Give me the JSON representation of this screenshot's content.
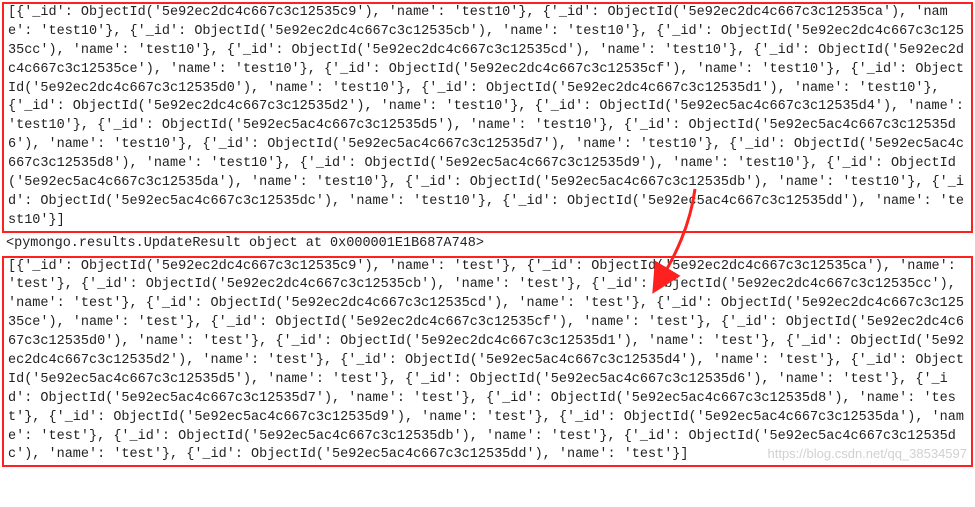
{
  "block1_text": "[{'_id': ObjectId('5e92ec2dc4c667c3c12535c9'), 'name': 'test10'}, {'_id': ObjectId('5e92ec2dc4c667c3c12535ca'), 'name': 'test10'}, {'_id': ObjectId('5e92ec2dc4c667c3c12535cb'), 'name': 'test10'}, {'_id': ObjectId('5e92ec2dc4c667c3c12535cc'), 'name': 'test10'}, {'_id': ObjectId('5e92ec2dc4c667c3c12535cd'), 'name': 'test10'}, {'_id': ObjectId('5e92ec2dc4c667c3c12535ce'), 'name': 'test10'}, {'_id': ObjectId('5e92ec2dc4c667c3c12535cf'), 'name': 'test10'}, {'_id': ObjectId('5e92ec2dc4c667c3c12535d0'), 'name': 'test10'}, {'_id': ObjectId('5e92ec2dc4c667c3c12535d1'), 'name': 'test10'}, {'_id': ObjectId('5e92ec2dc4c667c3c12535d2'), 'name': 'test10'}, {'_id': ObjectId('5e92ec5ac4c667c3c12535d4'), 'name': 'test10'}, {'_id': ObjectId('5e92ec5ac4c667c3c12535d5'), 'name': 'test10'}, {'_id': ObjectId('5e92ec5ac4c667c3c12535d6'), 'name': 'test10'}, {'_id': ObjectId('5e92ec5ac4c667c3c12535d7'), 'name': 'test10'}, {'_id': ObjectId('5e92ec5ac4c667c3c12535d8'), 'name': 'test10'}, {'_id': ObjectId('5e92ec5ac4c667c3c12535d9'), 'name': 'test10'}, {'_id': ObjectId('5e92ec5ac4c667c3c12535da'), 'name': 'test10'}, {'_id': ObjectId('5e92ec5ac4c667c3c12535db'), 'name': 'test10'}, {'_id': ObjectId('5e92ec5ac4c667c3c12535dc'), 'name': 'test10'}, {'_id': ObjectId('5e92ec5ac4c667c3c12535dd'), 'name': 'test10'}]",
  "mid_text": "<pymongo.results.UpdateResult object at 0x000001E1B687A748>",
  "block2_text": "[{'_id': ObjectId('5e92ec2dc4c667c3c12535c9'), 'name': 'test'}, {'_id': ObjectId('5e92ec2dc4c667c3c12535ca'), 'name': 'test'}, {'_id': ObjectId('5e92ec2dc4c667c3c12535cb'), 'name': 'test'}, {'_id': ObjectId('5e92ec2dc4c667c3c12535cc'), 'name': 'test'}, {'_id': ObjectId('5e92ec2dc4c667c3c12535cd'), 'name': 'test'}, {'_id': ObjectId('5e92ec2dc4c667c3c12535ce'), 'name': 'test'}, {'_id': ObjectId('5e92ec2dc4c667c3c12535cf'), 'name': 'test'}, {'_id': ObjectId('5e92ec2dc4c667c3c12535d0'), 'name': 'test'}, {'_id': ObjectId('5e92ec2dc4c667c3c12535d1'), 'name': 'test'}, {'_id': ObjectId('5e92ec2dc4c667c3c12535d2'), 'name': 'test'}, {'_id': ObjectId('5e92ec5ac4c667c3c12535d4'), 'name': 'test'}, {'_id': ObjectId('5e92ec5ac4c667c3c12535d5'), 'name': 'test'}, {'_id': ObjectId('5e92ec5ac4c667c3c12535d6'), 'name': 'test'}, {'_id': ObjectId('5e92ec5ac4c667c3c12535d7'), 'name': 'test'}, {'_id': ObjectId('5e92ec5ac4c667c3c12535d8'), 'name': 'test'}, {'_id': ObjectId('5e92ec5ac4c667c3c12535d9'), 'name': 'test'}, {'_id': ObjectId('5e92ec5ac4c667c3c12535da'), 'name': 'test'}, {'_id': ObjectId('5e92ec5ac4c667c3c12535db'), 'name': 'test'}, {'_id': ObjectId('5e92ec5ac4c667c3c12535dc'), 'name': 'test'}, {'_id': ObjectId('5e92ec5ac4c667c3c12535dd'), 'name': 'test'}]",
  "watermark": "https://blog.csdn.net/qq_38534597",
  "annotation": {
    "arrow_color": "#ff2020",
    "box_color": "#ff2020"
  }
}
